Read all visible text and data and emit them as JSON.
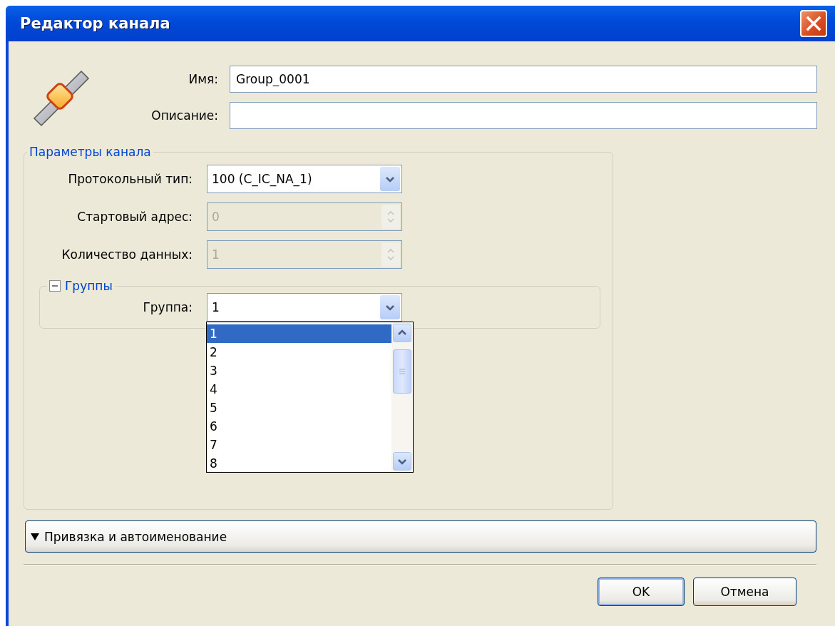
{
  "window": {
    "title": "Редактор канала"
  },
  "fields": [
    {
      "label": "Имя:",
      "value": "Group_0001"
    },
    {
      "label": "Описание:"
    }
  ],
  "channel_params": {
    "title": "Параметры канала",
    "rows": [
      {
        "kind": "combo",
        "label": "Протокольный тип:",
        "value": "100 (C_IC_NA_1)",
        "disabled": false
      },
      {
        "kind": "spin",
        "label": "Стартовый адрес:",
        "value": "0",
        "disabled": true
      },
      {
        "kind": "spin",
        "label": "Количество данных:",
        "value": "1",
        "disabled": true
      }
    ],
    "groups": {
      "title": "Группы",
      "expanded": true,
      "rows": [
        {
          "kind": "combo",
          "label": "Группа:",
          "value": "1",
          "disabled": false,
          "open": true,
          "options": [
            {
              "label": "1",
              "selected": true
            },
            {
              "label": "2",
              "selected": false
            },
            {
              "label": "3",
              "selected": false
            },
            {
              "label": "4",
              "selected": false
            },
            {
              "label": "5",
              "selected": false
            },
            {
              "label": "6",
              "selected": false
            },
            {
              "label": "7",
              "selected": false
            },
            {
              "label": "8",
              "selected": false
            }
          ]
        }
      ]
    }
  },
  "expander": {
    "label": "Привязка и автоименование"
  },
  "buttons": [
    {
      "label": "OK",
      "default": true
    },
    {
      "label": "Отмена",
      "default": false
    }
  ]
}
